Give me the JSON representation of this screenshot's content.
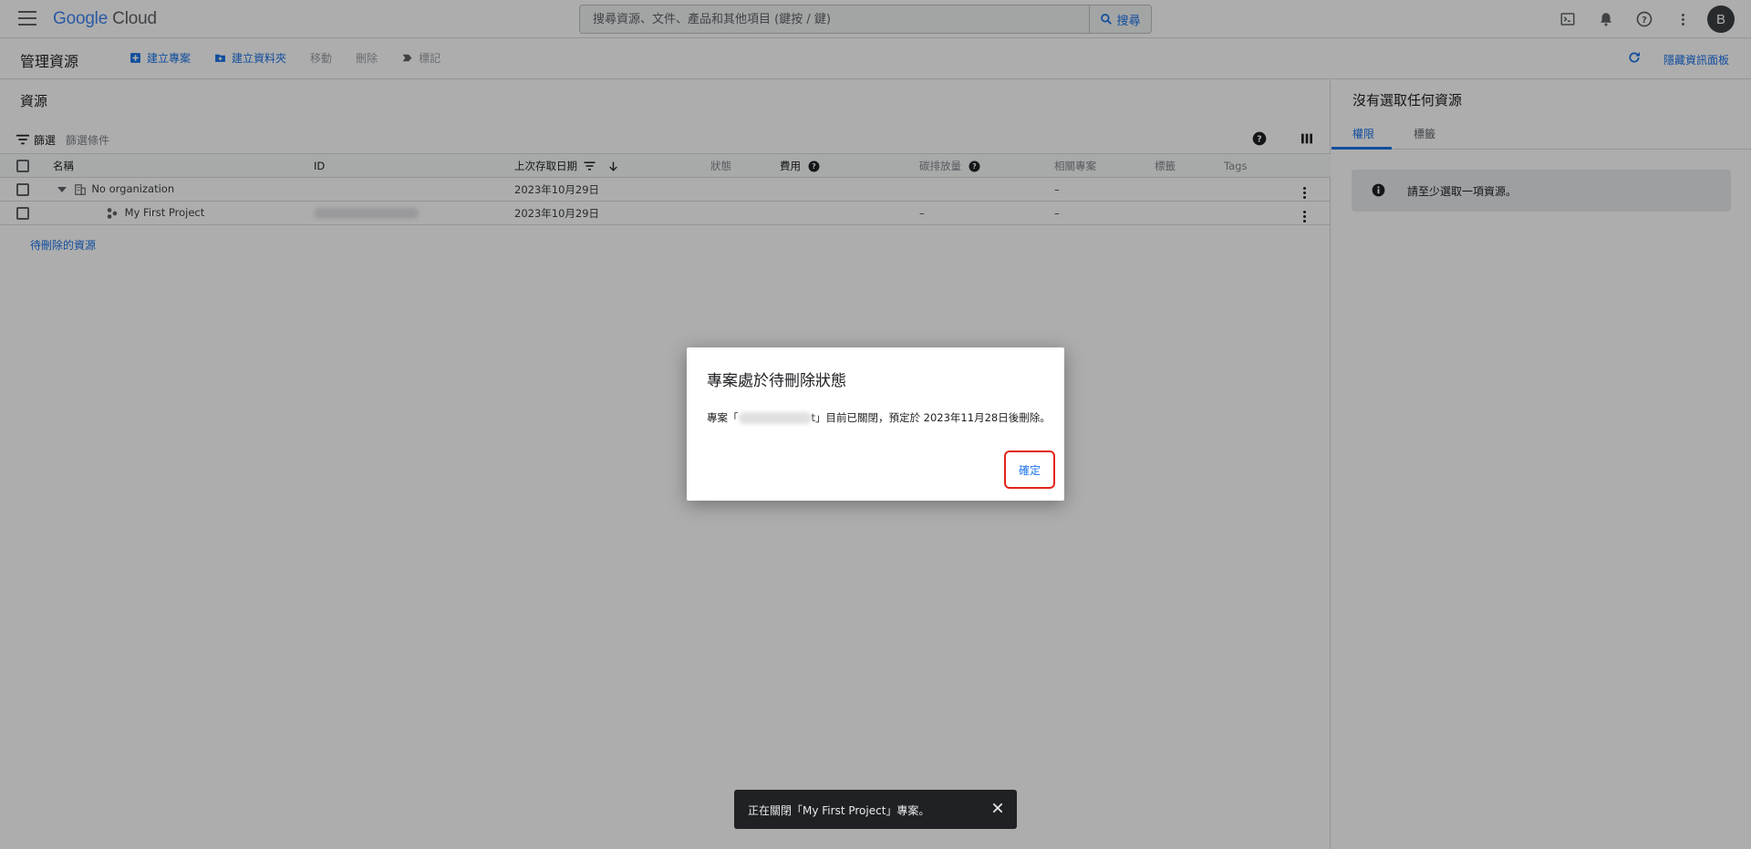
{
  "header": {
    "logo_google": "Google",
    "logo_cloud": "Cloud",
    "search_placeholder": "搜尋資源、文件、產品和其他項目 (鍵按 / 鍵)",
    "search_button": "搜尋",
    "avatar_letter": "B"
  },
  "actionbar": {
    "title": "管理資源",
    "create_project": "建立專案",
    "create_folder": "建立資料夾",
    "move": "移動",
    "delete": "刪除",
    "tag": "標記",
    "hide_panel": "隱藏資訊面板"
  },
  "resources": {
    "title": "資源",
    "filter_label": "篩選",
    "filter_placeholder": "篩選條件",
    "columns": {
      "name": "名稱",
      "id": "ID",
      "last_accessed": "上次存取日期",
      "status": "狀態",
      "cost": "費用",
      "carbon": "碳排放量",
      "related_projects": "相關專案",
      "labels": "標籤",
      "tags": "Tags"
    },
    "rows": [
      {
        "name": "No organization",
        "date": "2023年10月29日",
        "carbon": "",
        "related": "–"
      },
      {
        "name": "My First Project",
        "date": "2023年10月29日",
        "carbon": "–",
        "related": "–"
      }
    ],
    "pending_link": "待刪除的資源"
  },
  "side_panel": {
    "title": "沒有選取任何資源",
    "tab_permissions": "權限",
    "tab_labels": "標籤",
    "info_text": "請至少選取一項資源。"
  },
  "dialog": {
    "title": "專案處於待刪除狀態",
    "body_prefix": "專案「",
    "body_suffix_char": "t",
    "body_suffix": "」目前已關閉，預定於 2023年11月28日後刪除。",
    "ok_button": "確定"
  },
  "snackbar": {
    "message": "正在關閉「My First Project」專案。"
  },
  "colors": {
    "accent": "#1a73e8",
    "highlight_border": "#e1251b",
    "snackbar_bg": "#202124"
  }
}
